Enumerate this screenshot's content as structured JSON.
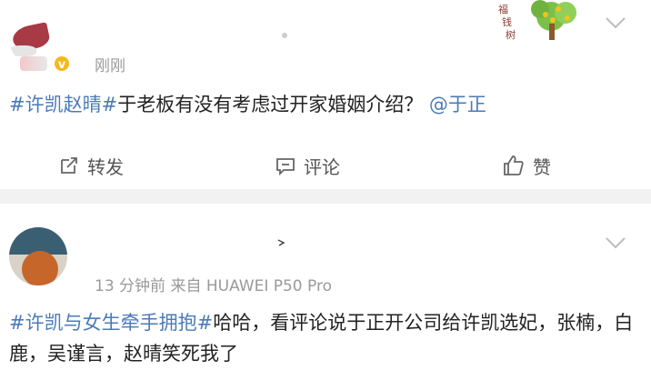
{
  "colors": {
    "link": "#4a7bb7",
    "text": "#222222",
    "meta": "#9a9a9a",
    "divider": "#f2f2f2",
    "badge": "#f6b81a"
  },
  "post1": {
    "time": "刚刚",
    "badge": "v",
    "sticker_text": [
      "福",
      "钱",
      "树"
    ],
    "body": {
      "topic": "#许凯赵晴#",
      "text": "于老板有没有考虑过开家婚姻介绍？",
      "mention": "@于正"
    },
    "actions": {
      "repost": "转发",
      "comment": "评论",
      "like": "赞"
    }
  },
  "post2": {
    "meta": "13 分钟前  来自 HUAWEI P50 Pro",
    "body": {
      "topic": "#许凯与女生牵手拥抱#",
      "text": "哈哈，看评论说于正开公司给许凯选妃，张楠，白鹿，吴谨言，赵晴笑死我了"
    }
  },
  "icons": [
    "chevron-down-icon",
    "repost-icon",
    "comment-icon",
    "like-icon",
    "verified-badge-icon"
  ]
}
